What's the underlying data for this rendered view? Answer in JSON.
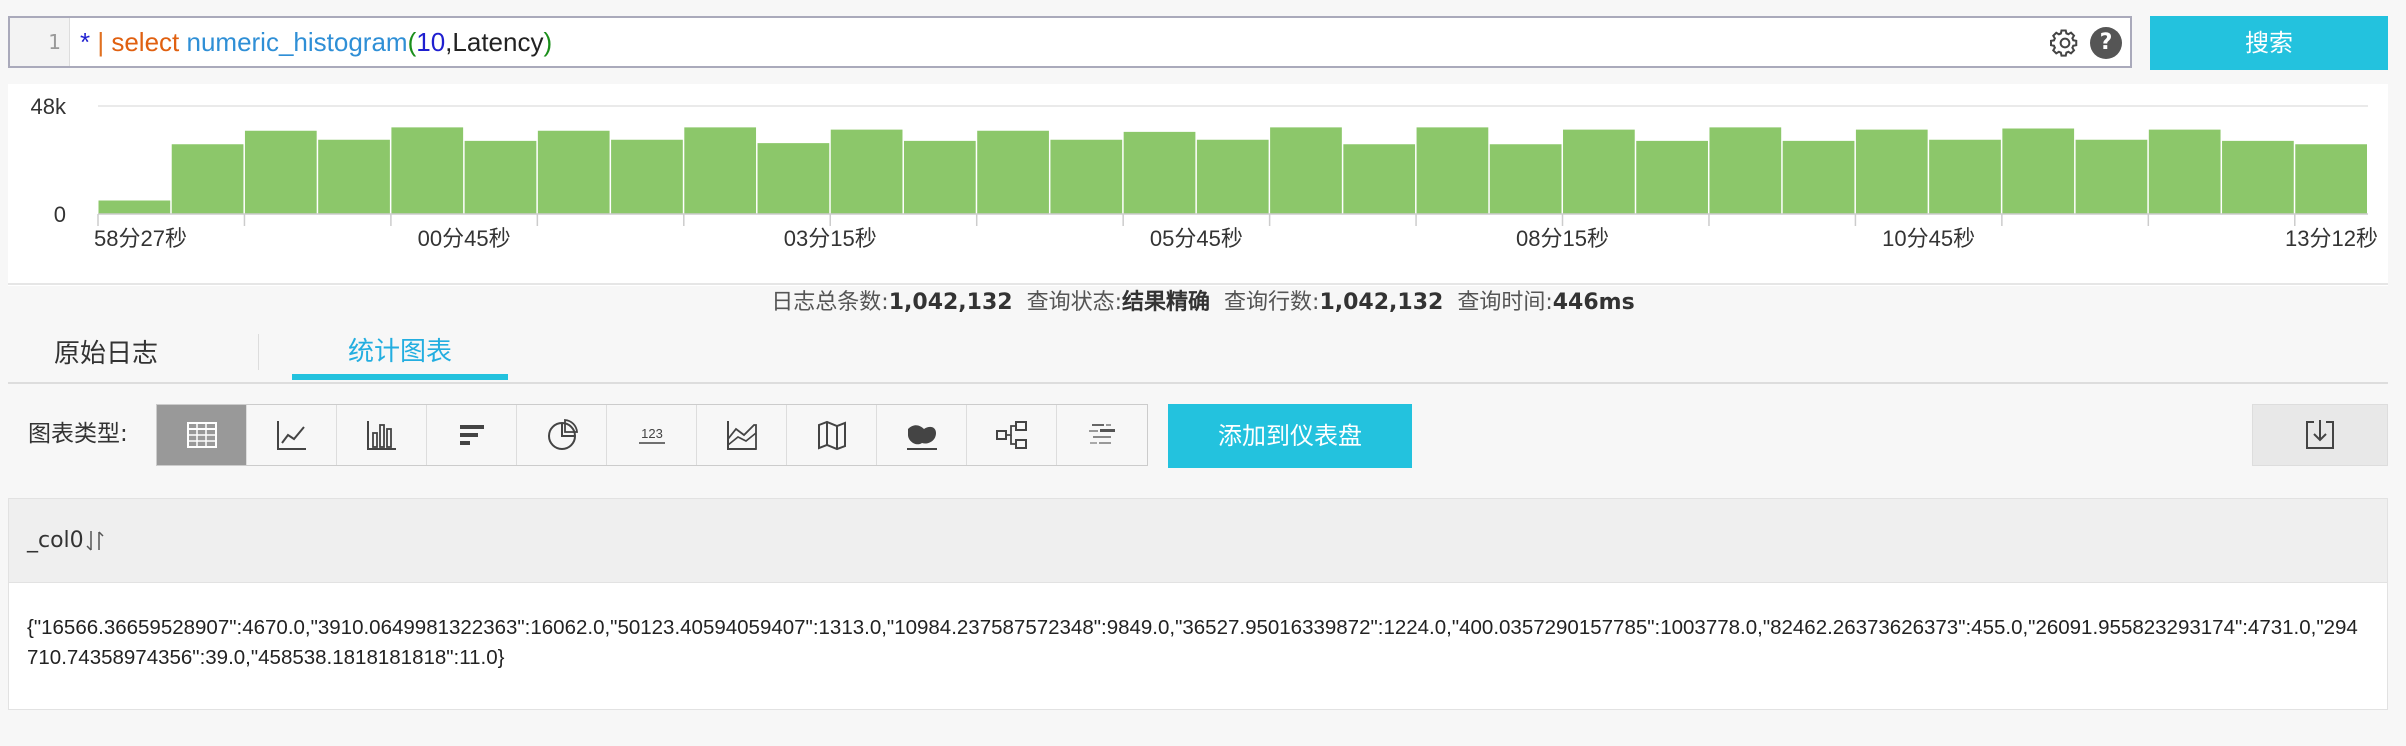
{
  "query": {
    "line_number": "1",
    "tokens": [
      {
        "text": "*",
        "kind": "star"
      },
      {
        "text": " | ",
        "kind": "pipe"
      },
      {
        "text": "select",
        "kind": "kw"
      },
      {
        "text": " ",
        "kind": "ident"
      },
      {
        "text": "numeric_histogram",
        "kind": "fn"
      },
      {
        "text": "(",
        "kind": "paren"
      },
      {
        "text": "10",
        "kind": "num"
      },
      {
        "text": ",Latency",
        "kind": "ident"
      },
      {
        "text": ")",
        "kind": "paren"
      }
    ],
    "search_label": "搜索",
    "help_label": "?"
  },
  "histogram": {
    "y_ticks": [
      "48k",
      "0"
    ],
    "y_max": 48000,
    "x_labels": [
      "58分27秒",
      "00分45秒",
      "03分15秒",
      "05分45秒",
      "08分15秒",
      "10分45秒",
      "13分12秒"
    ],
    "values": [
      6000,
      31000,
      37000,
      33000,
      38500,
      32500,
      37000,
      33000,
      38500,
      31500,
      37500,
      32500,
      37000,
      33000,
      36500,
      33000,
      38500,
      31000,
      38500,
      31000,
      37500,
      32500,
      38500,
      32500,
      37500,
      33000,
      38000,
      33000,
      37500,
      32500,
      31000
    ],
    "bar_color": "#8cc76a"
  },
  "status": {
    "total_label": "日志总条数:",
    "total_value": "1,042,132",
    "state_label": "查询状态:",
    "state_value": "结果精确",
    "rows_label": "查询行数:",
    "rows_value": "1,042,132",
    "time_label": "查询时间:",
    "time_value": "446ms"
  },
  "tabs": {
    "raw_logs": "原始日志",
    "charts": "统计图表"
  },
  "chart_toolbar": {
    "type_label": "图表类型:",
    "number_icon_text": "123",
    "add_dashboard_label": "添加到仪表盘",
    "icons": [
      "table-icon",
      "line-chart-icon",
      "column-chart-icon",
      "bar-chart-icon",
      "pie-chart-icon",
      "number-icon",
      "area-chart-icon",
      "map-icon",
      "heatmap-icon",
      "flow-chart-icon",
      "word-cloud-icon"
    ]
  },
  "table": {
    "column": "_col0",
    "cell": "{\"16566.36659528907\":4670.0,\"3910.0649981322363\":16062.0,\"50123.40594059407\":1313.0,\"10984.237587572348\":9849.0,\"36527.95016339872\":1224.0,\"400.0357290157785\":1003778.0,\"82462.26373626373\":455.0,\"26091.955823293174\":4731.0,\"294710.74358974356\":39.0,\"458538.1818181818\":11.0}"
  },
  "colors": {
    "accent": "#23c2de",
    "active_tab": "#23aee0"
  }
}
